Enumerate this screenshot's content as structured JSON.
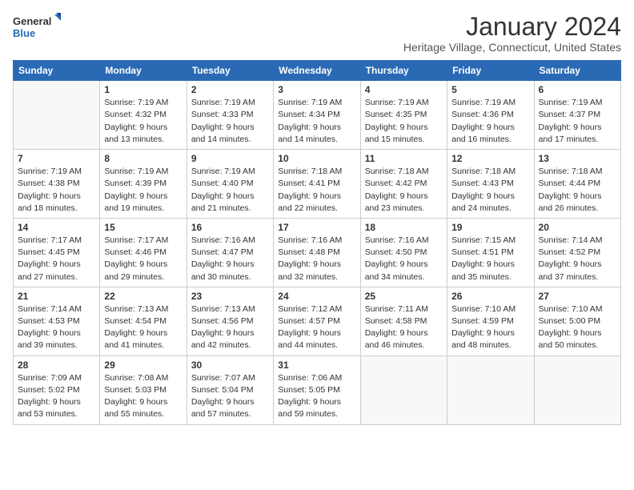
{
  "logo": {
    "general": "General",
    "blue": "Blue"
  },
  "title": "January 2024",
  "location": "Heritage Village, Connecticut, United States",
  "days_of_week": [
    "Sunday",
    "Monday",
    "Tuesday",
    "Wednesday",
    "Thursday",
    "Friday",
    "Saturday"
  ],
  "weeks": [
    [
      {
        "day": "",
        "info": ""
      },
      {
        "day": "1",
        "info": "Sunrise: 7:19 AM\nSunset: 4:32 PM\nDaylight: 9 hours\nand 13 minutes."
      },
      {
        "day": "2",
        "info": "Sunrise: 7:19 AM\nSunset: 4:33 PM\nDaylight: 9 hours\nand 14 minutes."
      },
      {
        "day": "3",
        "info": "Sunrise: 7:19 AM\nSunset: 4:34 PM\nDaylight: 9 hours\nand 14 minutes."
      },
      {
        "day": "4",
        "info": "Sunrise: 7:19 AM\nSunset: 4:35 PM\nDaylight: 9 hours\nand 15 minutes."
      },
      {
        "day": "5",
        "info": "Sunrise: 7:19 AM\nSunset: 4:36 PM\nDaylight: 9 hours\nand 16 minutes."
      },
      {
        "day": "6",
        "info": "Sunrise: 7:19 AM\nSunset: 4:37 PM\nDaylight: 9 hours\nand 17 minutes."
      }
    ],
    [
      {
        "day": "7",
        "info": "Sunrise: 7:19 AM\nSunset: 4:38 PM\nDaylight: 9 hours\nand 18 minutes."
      },
      {
        "day": "8",
        "info": "Sunrise: 7:19 AM\nSunset: 4:39 PM\nDaylight: 9 hours\nand 19 minutes."
      },
      {
        "day": "9",
        "info": "Sunrise: 7:19 AM\nSunset: 4:40 PM\nDaylight: 9 hours\nand 21 minutes."
      },
      {
        "day": "10",
        "info": "Sunrise: 7:18 AM\nSunset: 4:41 PM\nDaylight: 9 hours\nand 22 minutes."
      },
      {
        "day": "11",
        "info": "Sunrise: 7:18 AM\nSunset: 4:42 PM\nDaylight: 9 hours\nand 23 minutes."
      },
      {
        "day": "12",
        "info": "Sunrise: 7:18 AM\nSunset: 4:43 PM\nDaylight: 9 hours\nand 24 minutes."
      },
      {
        "day": "13",
        "info": "Sunrise: 7:18 AM\nSunset: 4:44 PM\nDaylight: 9 hours\nand 26 minutes."
      }
    ],
    [
      {
        "day": "14",
        "info": "Sunrise: 7:17 AM\nSunset: 4:45 PM\nDaylight: 9 hours\nand 27 minutes."
      },
      {
        "day": "15",
        "info": "Sunrise: 7:17 AM\nSunset: 4:46 PM\nDaylight: 9 hours\nand 29 minutes."
      },
      {
        "day": "16",
        "info": "Sunrise: 7:16 AM\nSunset: 4:47 PM\nDaylight: 9 hours\nand 30 minutes."
      },
      {
        "day": "17",
        "info": "Sunrise: 7:16 AM\nSunset: 4:48 PM\nDaylight: 9 hours\nand 32 minutes."
      },
      {
        "day": "18",
        "info": "Sunrise: 7:16 AM\nSunset: 4:50 PM\nDaylight: 9 hours\nand 34 minutes."
      },
      {
        "day": "19",
        "info": "Sunrise: 7:15 AM\nSunset: 4:51 PM\nDaylight: 9 hours\nand 35 minutes."
      },
      {
        "day": "20",
        "info": "Sunrise: 7:14 AM\nSunset: 4:52 PM\nDaylight: 9 hours\nand 37 minutes."
      }
    ],
    [
      {
        "day": "21",
        "info": "Sunrise: 7:14 AM\nSunset: 4:53 PM\nDaylight: 9 hours\nand 39 minutes."
      },
      {
        "day": "22",
        "info": "Sunrise: 7:13 AM\nSunset: 4:54 PM\nDaylight: 9 hours\nand 41 minutes."
      },
      {
        "day": "23",
        "info": "Sunrise: 7:13 AM\nSunset: 4:56 PM\nDaylight: 9 hours\nand 42 minutes."
      },
      {
        "day": "24",
        "info": "Sunrise: 7:12 AM\nSunset: 4:57 PM\nDaylight: 9 hours\nand 44 minutes."
      },
      {
        "day": "25",
        "info": "Sunrise: 7:11 AM\nSunset: 4:58 PM\nDaylight: 9 hours\nand 46 minutes."
      },
      {
        "day": "26",
        "info": "Sunrise: 7:10 AM\nSunset: 4:59 PM\nDaylight: 9 hours\nand 48 minutes."
      },
      {
        "day": "27",
        "info": "Sunrise: 7:10 AM\nSunset: 5:00 PM\nDaylight: 9 hours\nand 50 minutes."
      }
    ],
    [
      {
        "day": "28",
        "info": "Sunrise: 7:09 AM\nSunset: 5:02 PM\nDaylight: 9 hours\nand 53 minutes."
      },
      {
        "day": "29",
        "info": "Sunrise: 7:08 AM\nSunset: 5:03 PM\nDaylight: 9 hours\nand 55 minutes."
      },
      {
        "day": "30",
        "info": "Sunrise: 7:07 AM\nSunset: 5:04 PM\nDaylight: 9 hours\nand 57 minutes."
      },
      {
        "day": "31",
        "info": "Sunrise: 7:06 AM\nSunset: 5:05 PM\nDaylight: 9 hours\nand 59 minutes."
      },
      {
        "day": "",
        "info": ""
      },
      {
        "day": "",
        "info": ""
      },
      {
        "day": "",
        "info": ""
      }
    ]
  ]
}
